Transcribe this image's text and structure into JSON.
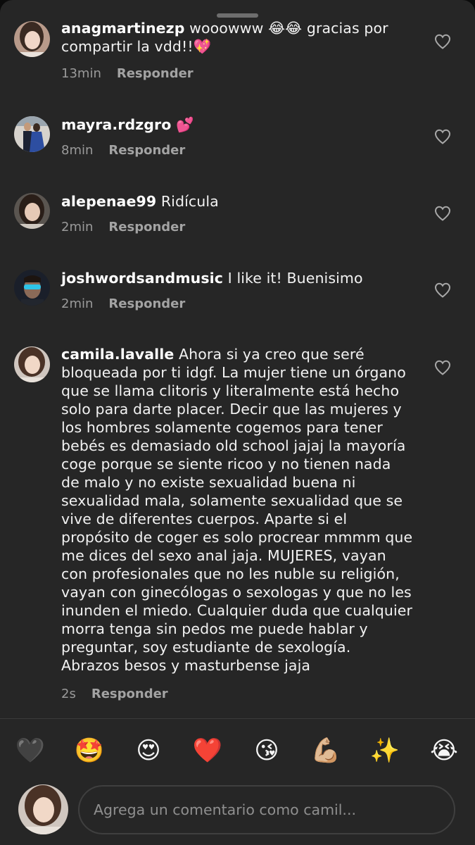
{
  "comments": [
    {
      "username": "anagmartinezp",
      "text": " wooowww 😂😂 gracias por compartir la vdd!!💖",
      "time": "13min",
      "reply_label": "Responder"
    },
    {
      "username": "mayra.rdzgro",
      "text": " 💕",
      "time": "8min",
      "reply_label": "Responder"
    },
    {
      "username": "alepenae99",
      "text": " Ridícula",
      "time": "2min",
      "reply_label": "Responder"
    },
    {
      "username": "joshwordsandmusic",
      "text": " I like it! Buenisimo",
      "time": "2min",
      "reply_label": "Responder"
    },
    {
      "username": "camila.lavalle",
      "text": " Ahora si ya creo que seré bloqueada por ti idgf. La mujer tiene un órgano que se llama clitoris y literalmente está hecho solo para darte placer. Decir que las mujeres y los hombres solamente cogemos para tener bebés es demasiado old school jajaj la mayoría coge porque se siente ricoo y no tienen nada de malo y no existe sexualidad buena ni sexualidad mala, solamente sexualidad que se vive de diferentes cuerpos. Aparte si el propósito de coger es solo procrear mmmm que me dices del sexo anal jaja. MUJERES, vayan con profesionales que no les nuble su religión, vayan con ginecólogas o sexologas y que no les inunden el miedo. Cualquier duda que cualquier morra tenga sin pedos me puede hablar y preguntar, soy estudiante de sexología. Abrazos besos y masturbense jaja",
      "time": "2s",
      "reply_label": "Responder"
    }
  ],
  "emoji_bar": [
    "🖤",
    "🤩",
    "😍",
    "❤️",
    "😘",
    "💪🏼",
    "✨",
    "😭"
  ],
  "composer": {
    "placeholder": "Agrega un comentario como camil..."
  },
  "icons": {
    "like": "heart-outline-icon"
  },
  "colors": {
    "sheet_background": "#262626",
    "secondary_text": "#9a9a9a"
  }
}
